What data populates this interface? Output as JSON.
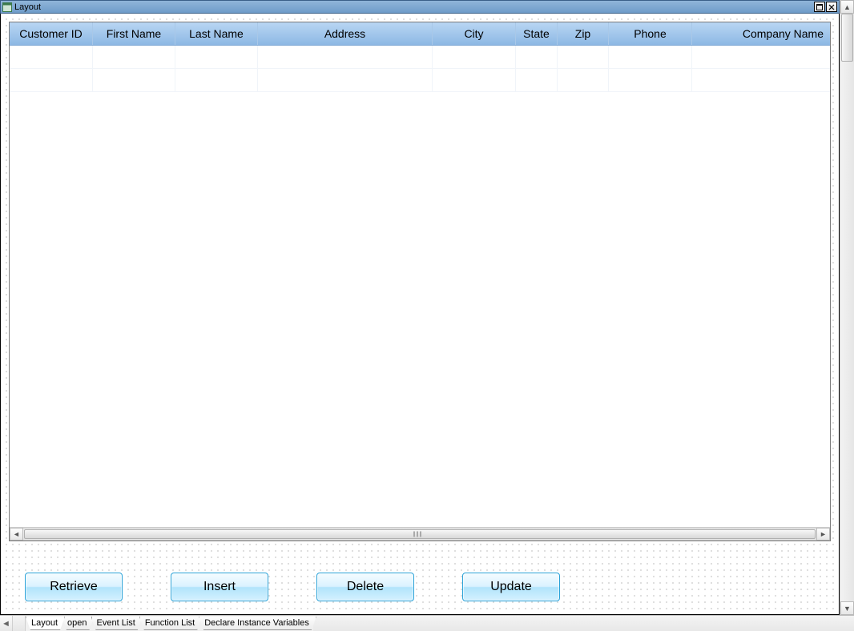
{
  "window": {
    "title": "Layout"
  },
  "grid": {
    "columns": [
      "Customer ID",
      "First Name",
      "Last Name",
      "Address",
      "City",
      "State",
      "Zip",
      "Phone",
      "Company Name"
    ],
    "rows": [
      [
        "",
        "",
        "",
        "",
        "",
        "",
        "",
        "",
        ""
      ],
      [
        "",
        "",
        "",
        "",
        "",
        "",
        "",
        "",
        ""
      ]
    ]
  },
  "buttons": {
    "retrieve": "Retrieve",
    "insert": "Insert",
    "delete": "Delete",
    "update": "Update"
  },
  "tabs": {
    "items": [
      "Layout",
      "open",
      "Event List",
      "Function List",
      "Declare Instance Variables"
    ],
    "active": "Layout"
  }
}
